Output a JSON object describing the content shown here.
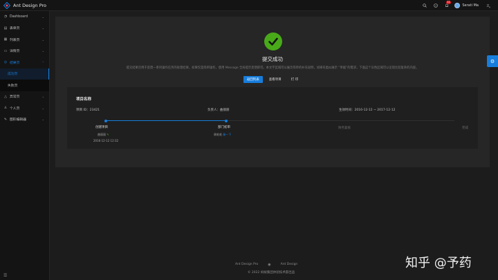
{
  "header": {
    "app_title": "Ant Design Pro",
    "user_name": "Serati Ma",
    "notification_count": "11",
    "icons": [
      "search-icon",
      "question-icon",
      "bell-icon",
      "translate-icon"
    ]
  },
  "sidebar": {
    "items": [
      {
        "label": "Dashboard",
        "icon": "dashboard-icon",
        "state": "collapsed"
      },
      {
        "label": "表单页",
        "icon": "form-icon",
        "state": "collapsed"
      },
      {
        "label": "列表页",
        "icon": "table-icon",
        "state": "collapsed"
      },
      {
        "label": "详情页",
        "icon": "profile-icon",
        "state": "collapsed"
      },
      {
        "label": "结果页",
        "icon": "check-circle-icon",
        "state": "open"
      },
      {
        "label": "异常页",
        "icon": "warning-icon",
        "state": "collapsed"
      },
      {
        "label": "个人页",
        "icon": "user-icon",
        "state": "collapsed"
      },
      {
        "label": "图形编辑器",
        "icon": "highlight-icon",
        "state": "collapsed"
      }
    ],
    "sub_items": [
      {
        "label": "成功页",
        "active": true
      },
      {
        "label": "失败页",
        "active": false
      }
    ]
  },
  "result": {
    "title": "提交成功",
    "description": "提交结果页用于反馈一系列操作任务的处理结果，如果仅是简单操作，使用 Message 全局提示反馈即可。本文字区域可以展示简单的补充说明，如果有类似展示 “单据”的需求，下面这个灰色区域可以呈现比较复杂的内容。",
    "buttons": {
      "back": "返回列表",
      "view": "查看项目",
      "print": "打 印"
    }
  },
  "project": {
    "title": "项目名称",
    "id_label": "项目 ID：",
    "id_value": "23421",
    "owner_label": "负责人：",
    "owner_value": "曲丽丽",
    "time_label": "生效时间：",
    "time_value": "2016-12-12 ~ 2017-12-12",
    "steps": [
      {
        "title": "创建项目",
        "sub1": "曲丽丽",
        "sub2": "2016-12-12 12:32",
        "status": "done"
      },
      {
        "title": "部门初审",
        "sub1": "周毛毛",
        "link": "催一下",
        "status": "done"
      },
      {
        "title": "财务复核",
        "status": "todo"
      },
      {
        "title": "完成",
        "status": "todo"
      }
    ]
  },
  "footer": {
    "link1": "Ant Design Pro",
    "link2": "Ant Design",
    "copyright": "© 2022 蚂蚁集团体验技术部出品"
  },
  "watermark": "知乎 @予药",
  "colors": {
    "primary": "#177ddc",
    "success": "#49aa19",
    "background": "#1c1c1c",
    "card": "#262626"
  }
}
